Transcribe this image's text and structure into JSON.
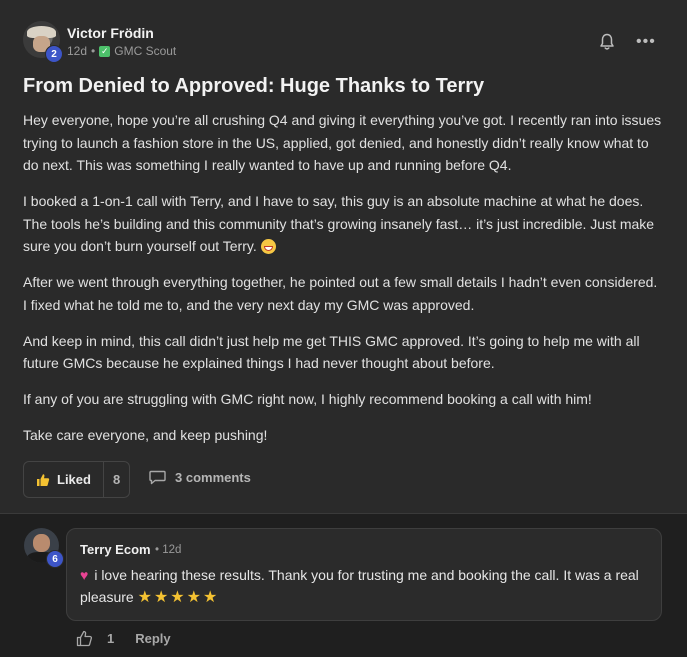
{
  "post": {
    "author": "Victor Frödin",
    "level": "2",
    "time": "12d",
    "separator": "•",
    "category": "GMC Scout",
    "title": "From Denied to Approved: Huge Thanks to Terry",
    "paragraphs": [
      "Hey everyone, hope you’re all crushing Q4 and giving it everything you’ve got. I recently ran into issues trying to launch a fashion store in the US, applied, got denied, and honestly didn’t really know what to do next. This was something I really wanted to have up and running before Q4.",
      "I booked a 1-on-1 call with Terry, and I have to say, this guy is an absolute machine at what he does. The tools he’s building and this community that’s growing insanely fast… it’s just incredible. Just make sure you don’t burn yourself out Terry.",
      "After we went through everything together, he pointed out a few small details I hadn’t even considered. I fixed what he told me to, and the very next day my GMC was approved.",
      "And keep in mind, this call didn’t just help me get THIS GMC approved. It’s going to help me with all future GMCs because he explained things I had never thought about before.",
      "If any of you are struggling with GMC right now, I highly recommend booking a call with him!",
      "Take care everyone, and keep pushing!"
    ],
    "liked_label": "Liked",
    "like_count": "8",
    "comments_label": "3 comments"
  },
  "comment": {
    "author": "Terry Ecom",
    "level": "6",
    "time": "• 12d",
    "text": "i love hearing these results. Thank you for trusting me and booking the call. It was a real pleasure",
    "stars": "★★★★★",
    "like_count": "1",
    "reply_label": "Reply"
  },
  "colors": {
    "background": "#2a2a2a",
    "comment_background": "#1f1f1f",
    "level_badge": "#3d55c8",
    "category_check": "#4cc06a",
    "star": "#f4c232",
    "heart": "#e84393"
  },
  "icons": [
    "bell-icon",
    "more-dots-icon",
    "thumbs-up-icon",
    "comment-icon",
    "heart-icon",
    "star-icon",
    "grin-emoji-icon",
    "check-icon"
  ]
}
